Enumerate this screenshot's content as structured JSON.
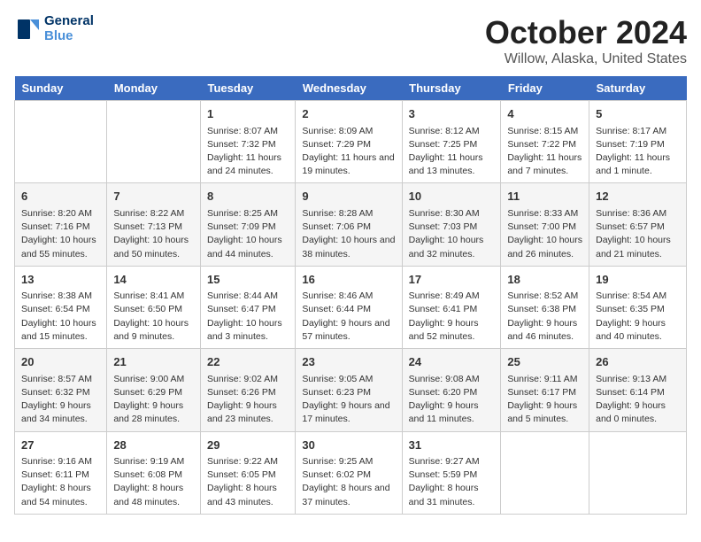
{
  "logo": {
    "line1": "General",
    "line2": "Blue"
  },
  "title": "October 2024",
  "subtitle": "Willow, Alaska, United States",
  "days_of_week": [
    "Sunday",
    "Monday",
    "Tuesday",
    "Wednesday",
    "Thursday",
    "Friday",
    "Saturday"
  ],
  "weeks": [
    [
      {
        "day": "",
        "info": ""
      },
      {
        "day": "",
        "info": ""
      },
      {
        "day": "1",
        "info": "Sunrise: 8:07 AM\nSunset: 7:32 PM\nDaylight: 11 hours and 24 minutes."
      },
      {
        "day": "2",
        "info": "Sunrise: 8:09 AM\nSunset: 7:29 PM\nDaylight: 11 hours and 19 minutes."
      },
      {
        "day": "3",
        "info": "Sunrise: 8:12 AM\nSunset: 7:25 PM\nDaylight: 11 hours and 13 minutes."
      },
      {
        "day": "4",
        "info": "Sunrise: 8:15 AM\nSunset: 7:22 PM\nDaylight: 11 hours and 7 minutes."
      },
      {
        "day": "5",
        "info": "Sunrise: 8:17 AM\nSunset: 7:19 PM\nDaylight: 11 hours and 1 minute."
      }
    ],
    [
      {
        "day": "6",
        "info": "Sunrise: 8:20 AM\nSunset: 7:16 PM\nDaylight: 10 hours and 55 minutes."
      },
      {
        "day": "7",
        "info": "Sunrise: 8:22 AM\nSunset: 7:13 PM\nDaylight: 10 hours and 50 minutes."
      },
      {
        "day": "8",
        "info": "Sunrise: 8:25 AM\nSunset: 7:09 PM\nDaylight: 10 hours and 44 minutes."
      },
      {
        "day": "9",
        "info": "Sunrise: 8:28 AM\nSunset: 7:06 PM\nDaylight: 10 hours and 38 minutes."
      },
      {
        "day": "10",
        "info": "Sunrise: 8:30 AM\nSunset: 7:03 PM\nDaylight: 10 hours and 32 minutes."
      },
      {
        "day": "11",
        "info": "Sunrise: 8:33 AM\nSunset: 7:00 PM\nDaylight: 10 hours and 26 minutes."
      },
      {
        "day": "12",
        "info": "Sunrise: 8:36 AM\nSunset: 6:57 PM\nDaylight: 10 hours and 21 minutes."
      }
    ],
    [
      {
        "day": "13",
        "info": "Sunrise: 8:38 AM\nSunset: 6:54 PM\nDaylight: 10 hours and 15 minutes."
      },
      {
        "day": "14",
        "info": "Sunrise: 8:41 AM\nSunset: 6:50 PM\nDaylight: 10 hours and 9 minutes."
      },
      {
        "day": "15",
        "info": "Sunrise: 8:44 AM\nSunset: 6:47 PM\nDaylight: 10 hours and 3 minutes."
      },
      {
        "day": "16",
        "info": "Sunrise: 8:46 AM\nSunset: 6:44 PM\nDaylight: 9 hours and 57 minutes."
      },
      {
        "day": "17",
        "info": "Sunrise: 8:49 AM\nSunset: 6:41 PM\nDaylight: 9 hours and 52 minutes."
      },
      {
        "day": "18",
        "info": "Sunrise: 8:52 AM\nSunset: 6:38 PM\nDaylight: 9 hours and 46 minutes."
      },
      {
        "day": "19",
        "info": "Sunrise: 8:54 AM\nSunset: 6:35 PM\nDaylight: 9 hours and 40 minutes."
      }
    ],
    [
      {
        "day": "20",
        "info": "Sunrise: 8:57 AM\nSunset: 6:32 PM\nDaylight: 9 hours and 34 minutes."
      },
      {
        "day": "21",
        "info": "Sunrise: 9:00 AM\nSunset: 6:29 PM\nDaylight: 9 hours and 28 minutes."
      },
      {
        "day": "22",
        "info": "Sunrise: 9:02 AM\nSunset: 6:26 PM\nDaylight: 9 hours and 23 minutes."
      },
      {
        "day": "23",
        "info": "Sunrise: 9:05 AM\nSunset: 6:23 PM\nDaylight: 9 hours and 17 minutes."
      },
      {
        "day": "24",
        "info": "Sunrise: 9:08 AM\nSunset: 6:20 PM\nDaylight: 9 hours and 11 minutes."
      },
      {
        "day": "25",
        "info": "Sunrise: 9:11 AM\nSunset: 6:17 PM\nDaylight: 9 hours and 5 minutes."
      },
      {
        "day": "26",
        "info": "Sunrise: 9:13 AM\nSunset: 6:14 PM\nDaylight: 9 hours and 0 minutes."
      }
    ],
    [
      {
        "day": "27",
        "info": "Sunrise: 9:16 AM\nSunset: 6:11 PM\nDaylight: 8 hours and 54 minutes."
      },
      {
        "day": "28",
        "info": "Sunrise: 9:19 AM\nSunset: 6:08 PM\nDaylight: 8 hours and 48 minutes."
      },
      {
        "day": "29",
        "info": "Sunrise: 9:22 AM\nSunset: 6:05 PM\nDaylight: 8 hours and 43 minutes."
      },
      {
        "day": "30",
        "info": "Sunrise: 9:25 AM\nSunset: 6:02 PM\nDaylight: 8 hours and 37 minutes."
      },
      {
        "day": "31",
        "info": "Sunrise: 9:27 AM\nSunset: 5:59 PM\nDaylight: 8 hours and 31 minutes."
      },
      {
        "day": "",
        "info": ""
      },
      {
        "day": "",
        "info": ""
      }
    ]
  ]
}
